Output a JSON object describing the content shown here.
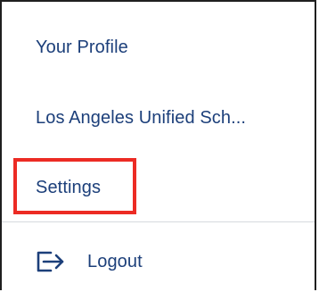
{
  "menu": {
    "items": [
      {
        "label": "Your Profile"
      },
      {
        "label": "Los Angeles Unified Sch..."
      },
      {
        "label": "Settings"
      }
    ],
    "logout": {
      "label": "Logout",
      "icon": "logout-arrow-icon"
    }
  },
  "colors": {
    "text": "#1c3f7a",
    "highlight": "#ec2b24",
    "border": "#1f1f1f",
    "divider": "#d6d9de"
  }
}
